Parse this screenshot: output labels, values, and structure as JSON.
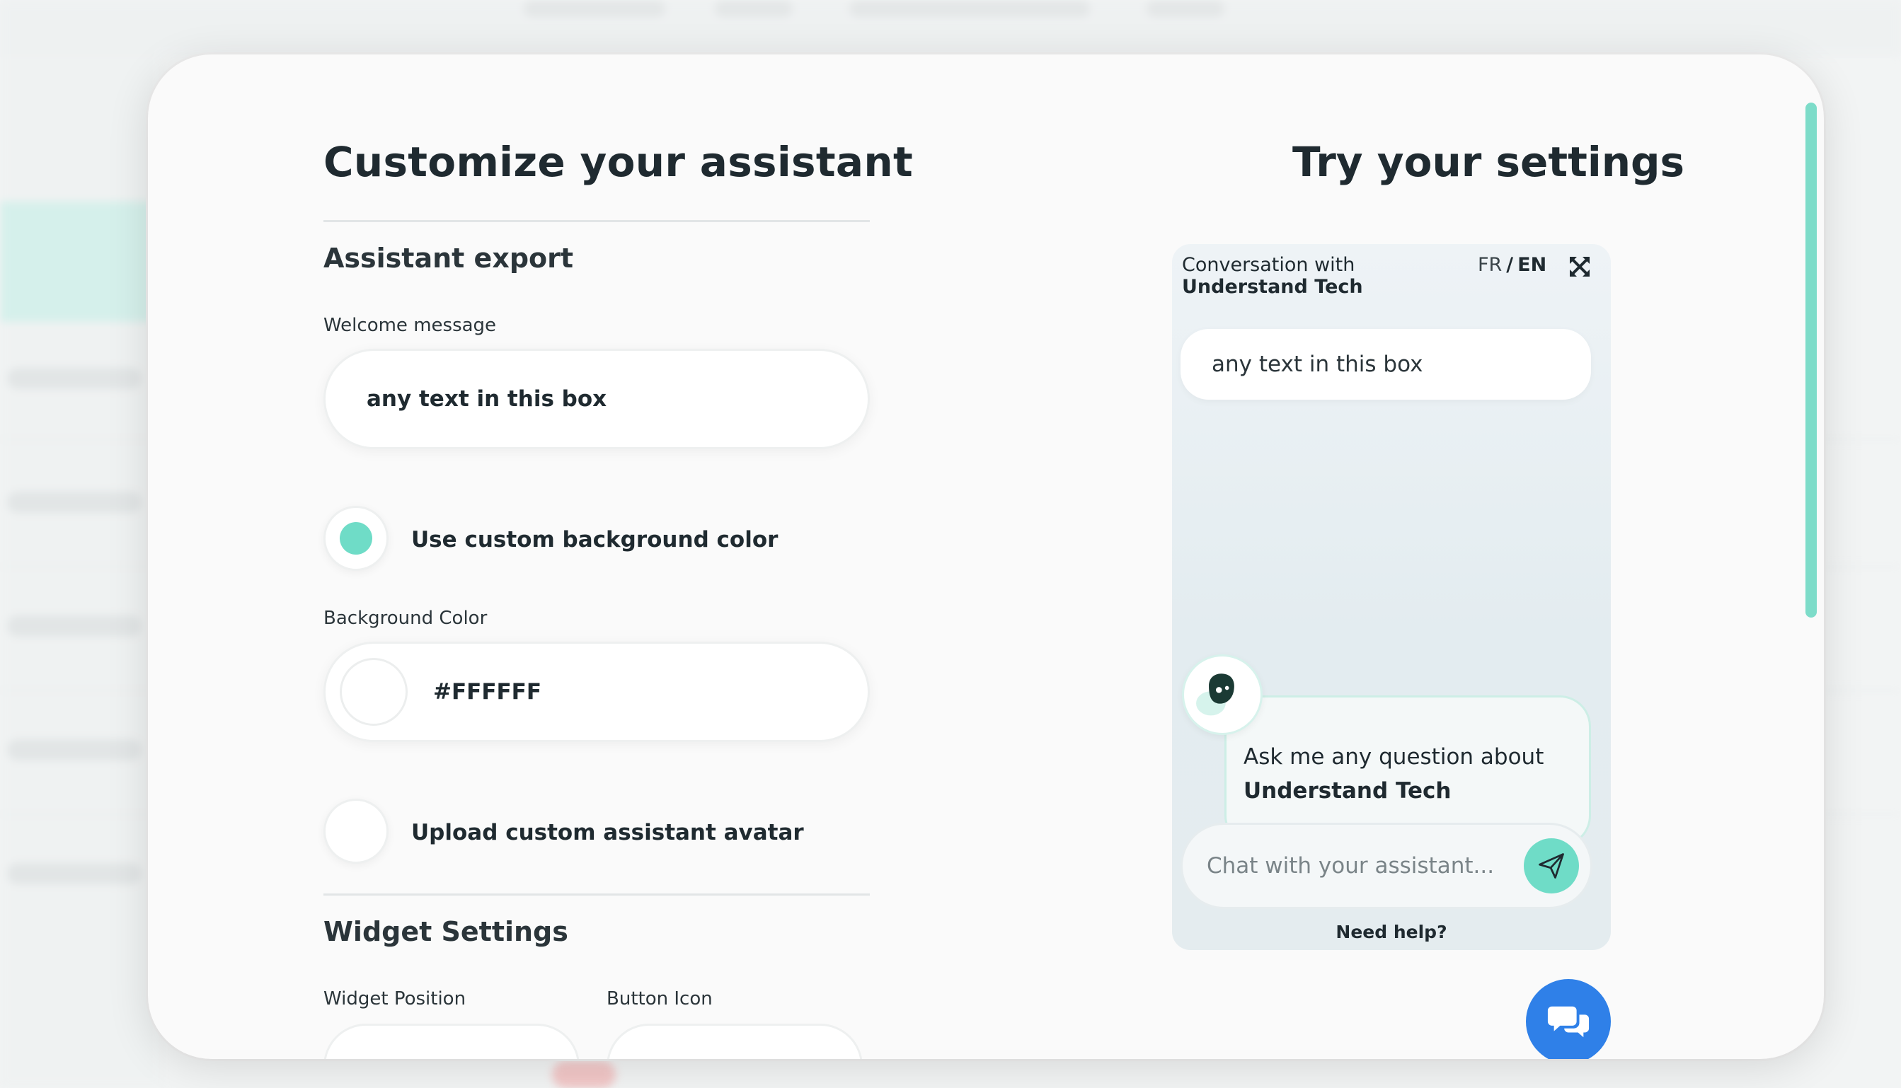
{
  "left_panel": {
    "title": "Customize your assistant",
    "section_export": "Assistant export",
    "welcome_label": "Welcome message",
    "welcome_value": "any text in this box",
    "custom_bg_label": "Use custom background color",
    "custom_bg_checked": true,
    "bg_color_label": "Background Color",
    "bg_color_value": "#FFFFFF",
    "upload_avatar_label": "Upload custom assistant avatar",
    "upload_avatar_checked": false,
    "section_widget": "Widget Settings",
    "widget_position_label": "Widget Position",
    "button_icon_label": "Button Icon"
  },
  "right_panel": {
    "title": "Try your settings",
    "widget": {
      "conversation_prefix": "Conversation with ",
      "conversation_name": "Understand Tech",
      "lang_fr": "FR",
      "lang_sep": "/",
      "lang_en": "EN",
      "welcome_text": "any text in this box",
      "bot_message_prefix": "Ask me any question about",
      "bot_message_name": "Understand Tech",
      "input_placeholder": "Chat with your assistant...",
      "help_link": "Need help?"
    }
  },
  "colors": {
    "accent": "#6fdcc7",
    "launcher": "#2f80e8",
    "text": "#1f2a30"
  },
  "icons": {
    "expand": "expand-icon",
    "send": "send-icon",
    "launcher": "chat-bubbles-icon",
    "avatar": "bot-avatar-icon"
  }
}
